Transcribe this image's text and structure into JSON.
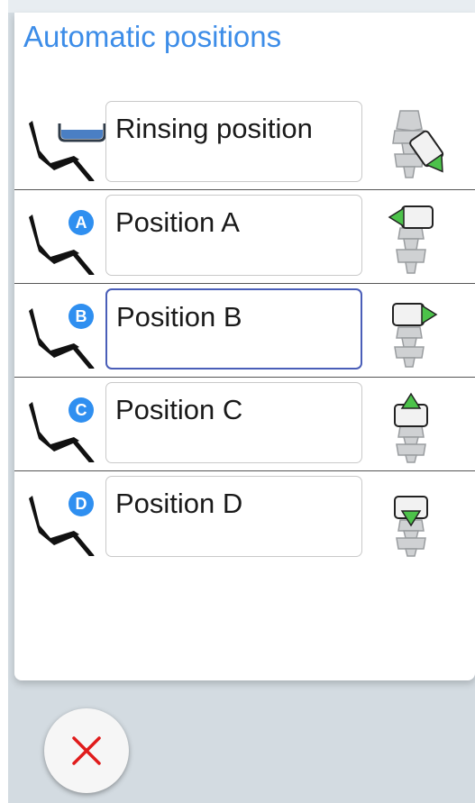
{
  "title": "Automatic positions",
  "rows": [
    {
      "label": "Rinsing position",
      "badge": "",
      "icon": "rinse-bowl-icon",
      "mode": "tilt-right"
    },
    {
      "label": "Position A",
      "badge": "A",
      "icon": "badge-a-icon",
      "mode": "left"
    },
    {
      "label": "Position B",
      "badge": "B",
      "icon": "badge-b-icon",
      "mode": "right"
    },
    {
      "label": "Position C",
      "badge": "C",
      "icon": "badge-c-icon",
      "mode": "up"
    },
    {
      "label": "Position D",
      "badge": "D",
      "icon": "badge-d-icon",
      "mode": "down"
    }
  ],
  "active_row": 2,
  "colors": {
    "accent": "#3d8de8",
    "badge": "#2f8ff0",
    "arrow": "#4cc24a",
    "close": "#e01b1b",
    "field_active_border": "#4a5eb8"
  }
}
